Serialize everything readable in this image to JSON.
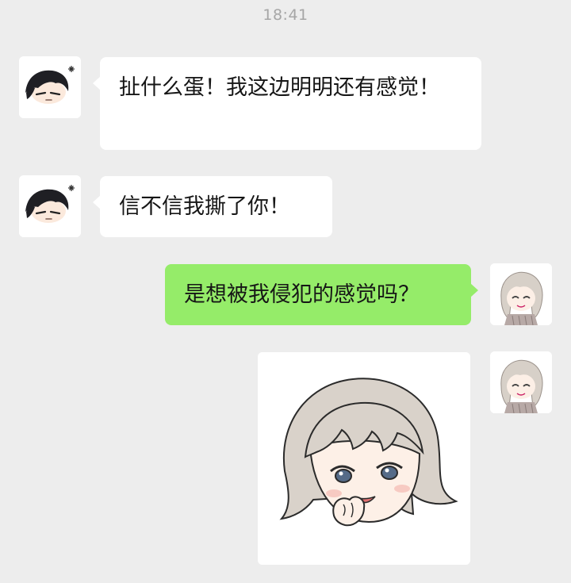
{
  "status": {
    "time": "18:41"
  },
  "messages": [
    {
      "sender": "left",
      "text": "扯什么蛋！我这边明明还有感觉！"
    },
    {
      "sender": "left",
      "text": "信不信我撕了你！"
    },
    {
      "sender": "right",
      "text": "是想被我侵犯的感觉吗？"
    },
    {
      "sender": "right",
      "type": "sticker",
      "sticker_icon": "smiling-character-sticker"
    }
  ],
  "avatars": {
    "left_icon": "dark-haired-character-avatar",
    "right_icon": "light-haired-character-avatar"
  },
  "colors": {
    "background": "#ededed",
    "incoming_bubble": "#ffffff",
    "outgoing_bubble": "#95ec69",
    "timestamp_text": "#a6a6a6"
  }
}
